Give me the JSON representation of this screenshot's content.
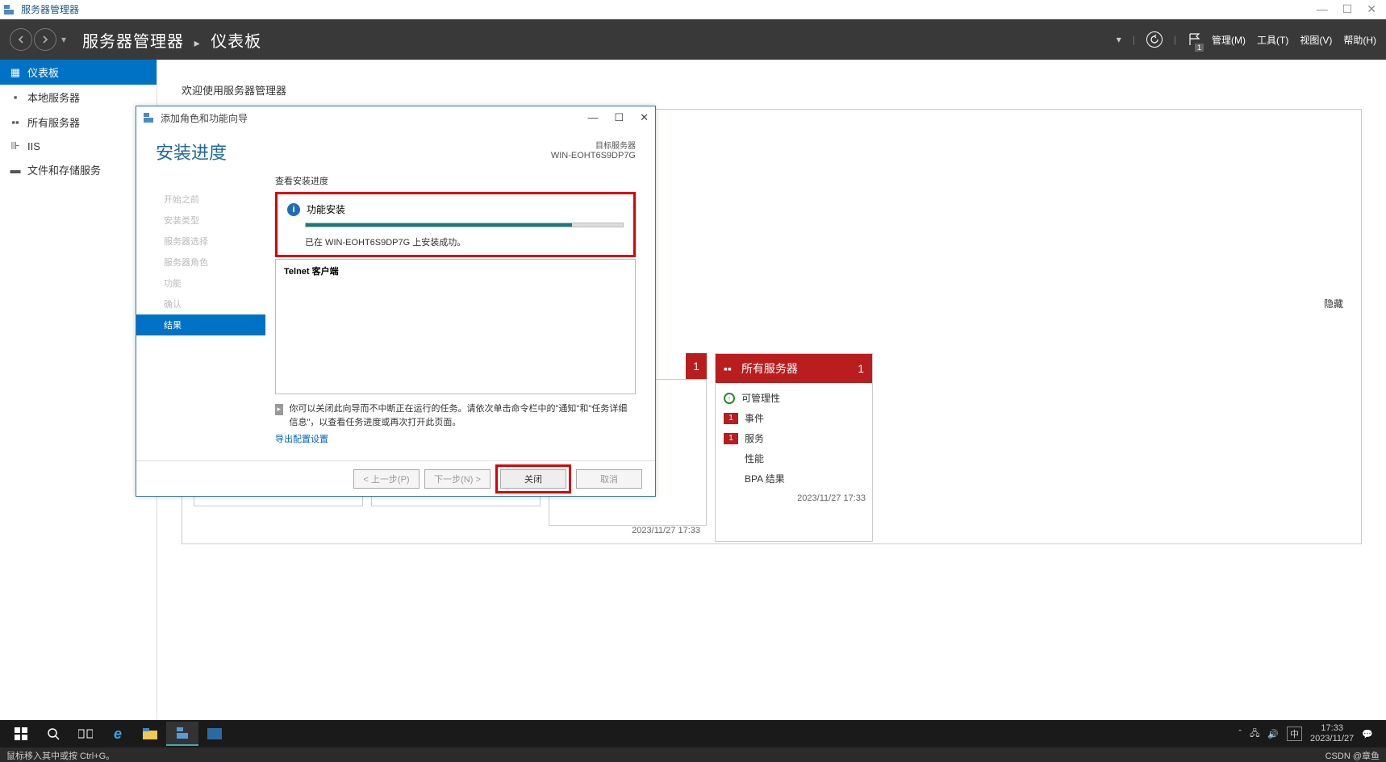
{
  "window": {
    "title": "服务器管理器"
  },
  "window_controls": {
    "min": "—",
    "max": "☐",
    "close": "✕"
  },
  "header": {
    "breadcrumb_root": "服务器管理器",
    "breadcrumb_page": "仪表板",
    "menu": {
      "manage": "管理(M)",
      "tools": "工具(T)",
      "view": "视图(V)",
      "help": "帮助(H)"
    },
    "flag_badge": "1"
  },
  "sidebar": {
    "items": [
      {
        "label": "仪表板"
      },
      {
        "label": "本地服务器"
      },
      {
        "label": "所有服务器"
      },
      {
        "label": "IIS"
      },
      {
        "label": "文件和存储服务"
      }
    ]
  },
  "content": {
    "welcome": "欢迎使用服务器管理器",
    "hide_label": "隐藏"
  },
  "tiles": {
    "header3_count": "1",
    "header4_title": "所有服务器",
    "header4_count": "1",
    "rows": {
      "manageability": "可管理性",
      "events": "事件",
      "services": "服务",
      "performance": "性能",
      "bpa": "BPA 结果",
      "events_count": "1",
      "services_count": "1"
    },
    "timestamp": "2023/11/27 17:33"
  },
  "wizard": {
    "title": "添加角色和功能向导",
    "heading": "安装进度",
    "target_label": "目标服务器",
    "target_server": "WIN-EOHT6S9DP7G",
    "steps": [
      "开始之前",
      "安装类型",
      "服务器选择",
      "服务器角色",
      "功能",
      "确认",
      "结果"
    ],
    "progress_section_label": "查看安装进度",
    "info_title": "功能安装",
    "success_msg": "已在 WIN-EOHT6S9DP7G 上安装成功。",
    "feature_name": "Telnet 客户端",
    "note": "你可以关闭此向导而不中断正在运行的任务。请依次单击命令栏中的\"通知\"和\"任务详细信息\"，以查看任务进度或再次打开此页面。",
    "export_link": "导出配置设置",
    "buttons": {
      "prev": "< 上一步(P)",
      "next": "下一步(N) >",
      "close": "关闭",
      "cancel": "取消"
    }
  },
  "taskbar": {
    "time": "17:33",
    "date": "2023/11/27",
    "ime": "中"
  },
  "statusline": {
    "left": "鼠标移入其中或按 Ctrl+G。",
    "right": "CSDN @章鱼"
  }
}
